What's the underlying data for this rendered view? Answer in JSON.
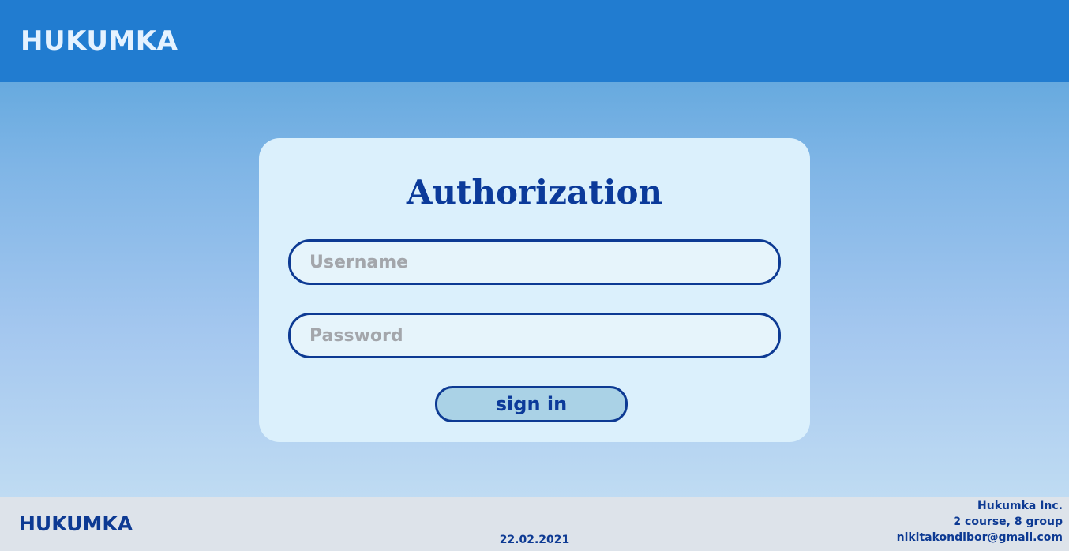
{
  "header": {
    "logo": "HUKUMKA"
  },
  "login": {
    "title": "Authorization",
    "username_placeholder": "Username",
    "username_value": "",
    "password_placeholder": "Password",
    "password_value": "",
    "signin_label": "sign in"
  },
  "footer": {
    "logo": "HUKUMKA",
    "date": "22.02.2021",
    "company": "Hukumka Inc.",
    "course": "2 course, 8 group",
    "email": "nikitakondibor@gmail.com"
  },
  "colors": {
    "header_bg": "#217cd0",
    "accent": "#0d3a93",
    "card_bg": "#dbf0fc",
    "button_bg": "#aad2e6",
    "footer_bg": "#dde3ea"
  }
}
